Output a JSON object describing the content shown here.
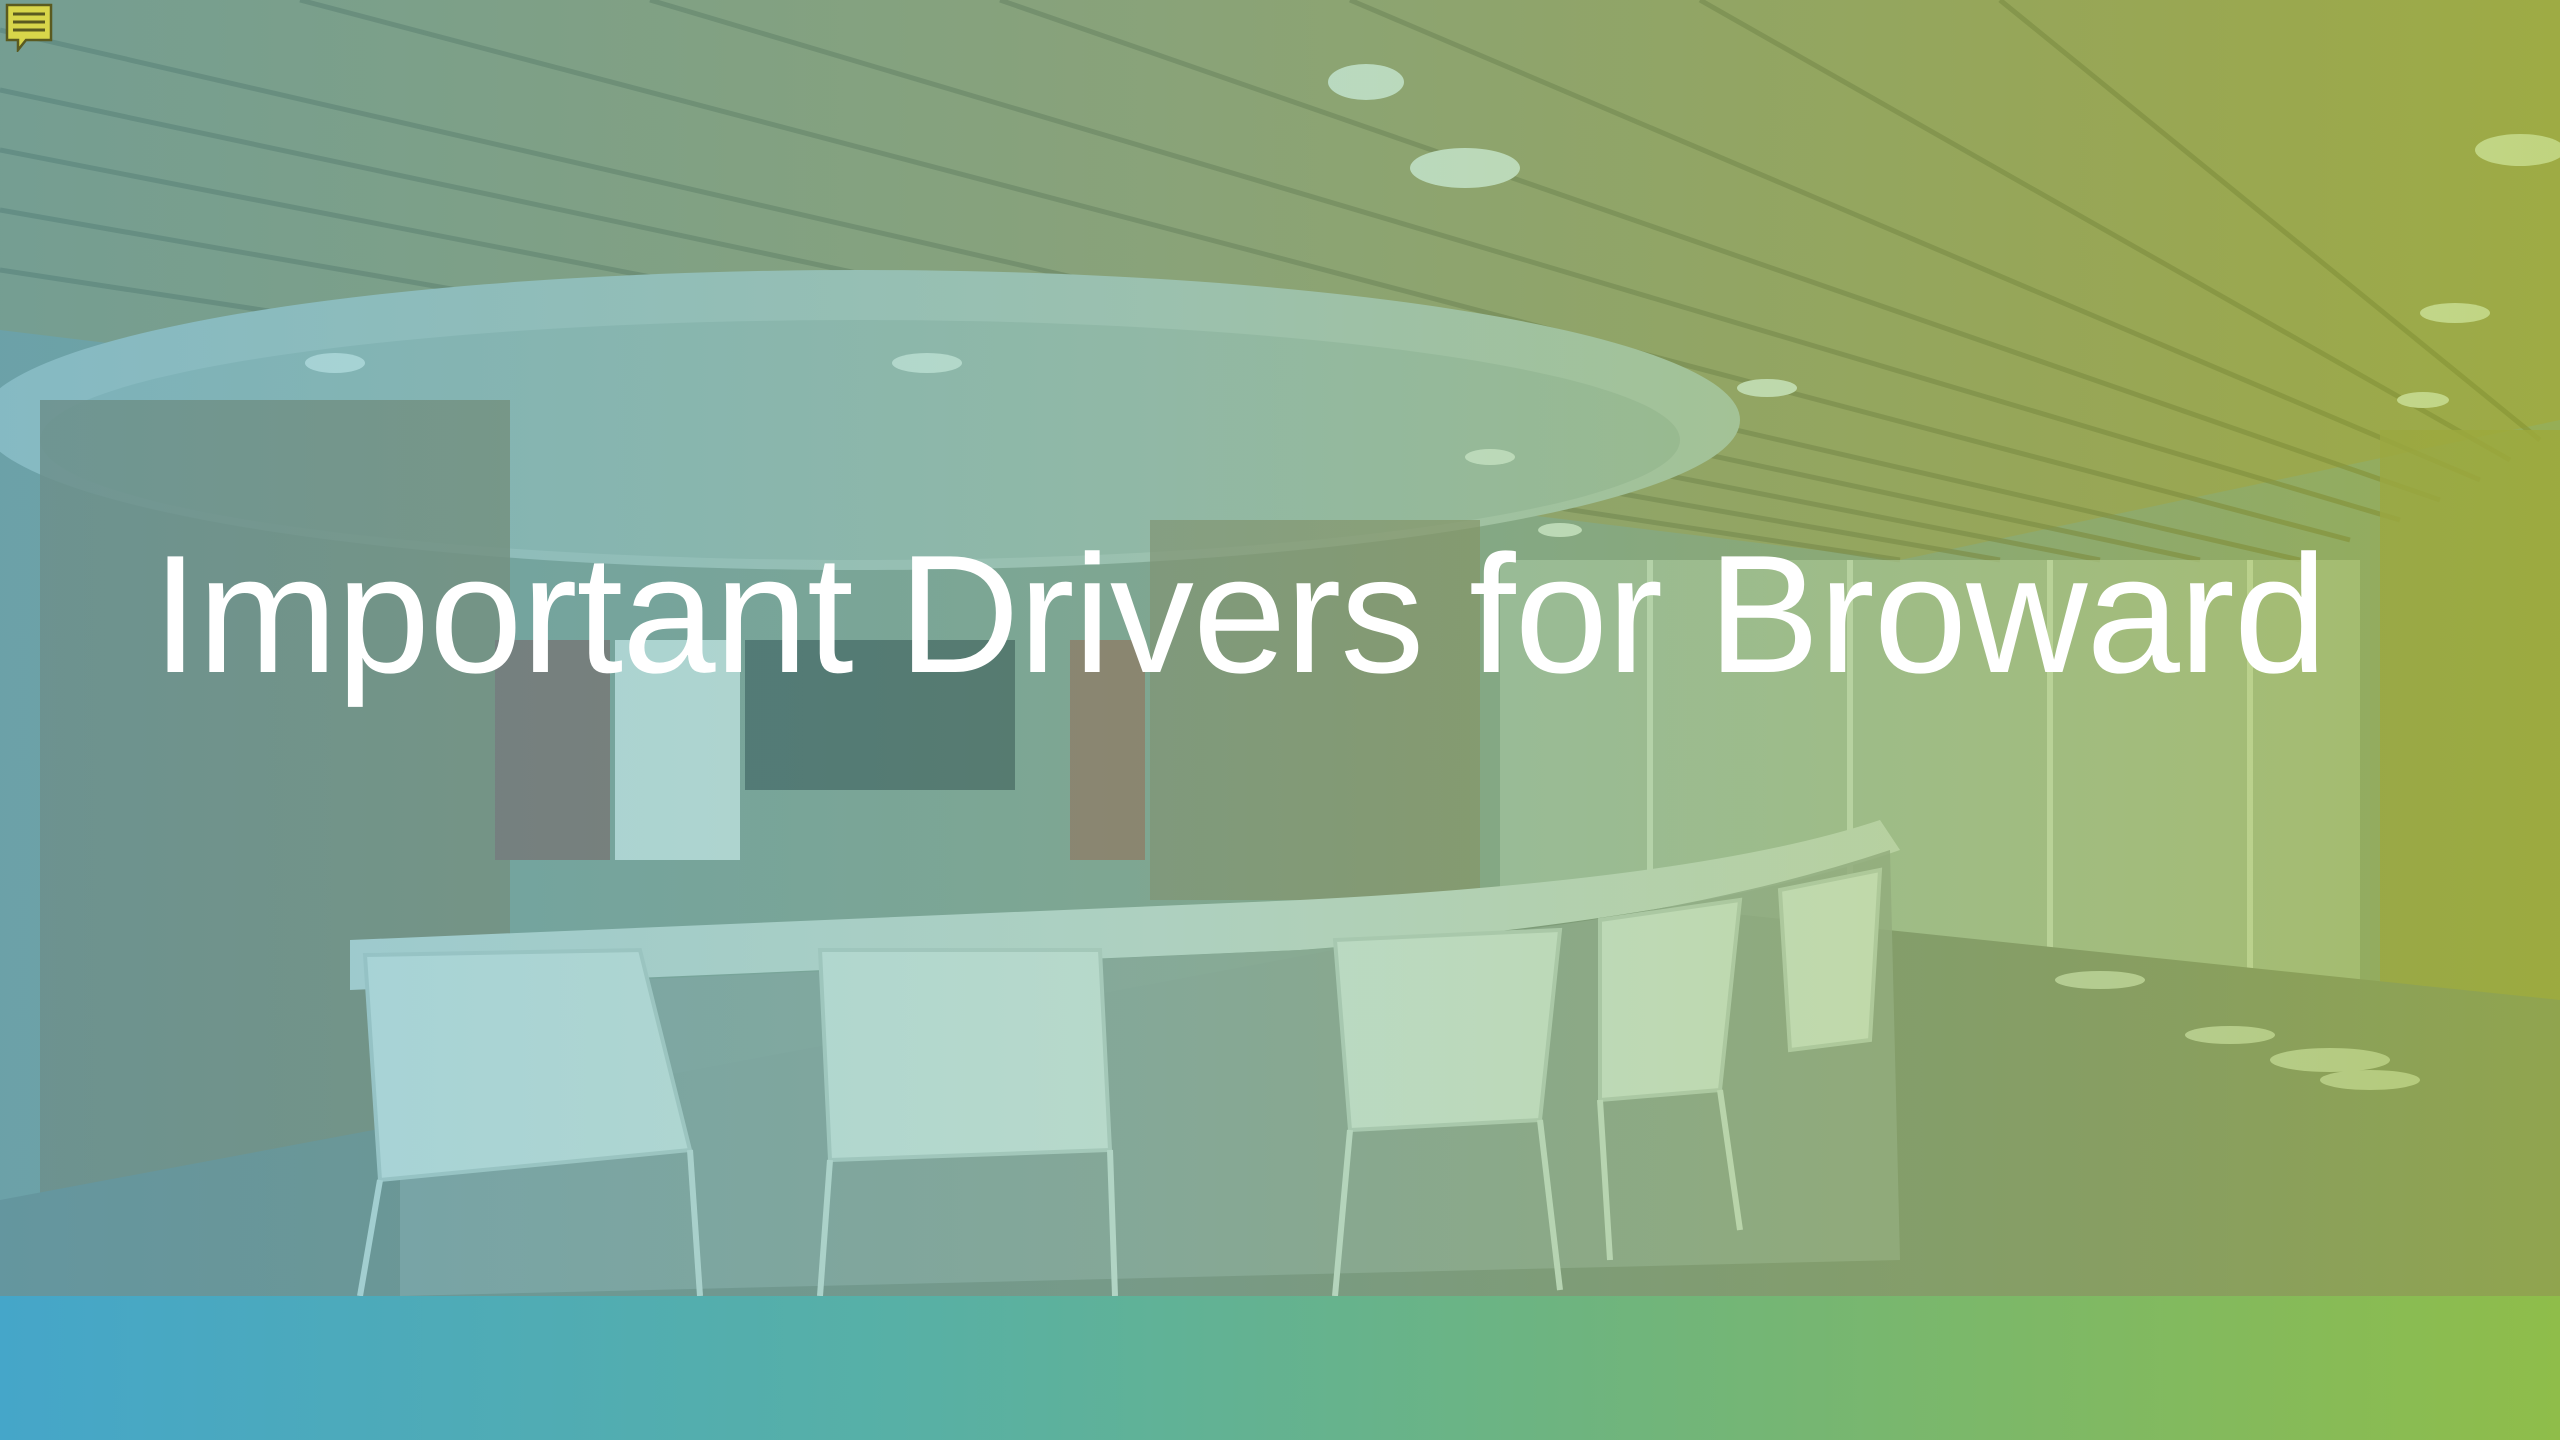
{
  "slide": {
    "title": "Important Drivers for Broward"
  },
  "icons": {
    "comment": "comment-icon"
  },
  "colors": {
    "band_left": "#45a6c9",
    "band_right": "#8fbd4a",
    "title_text": "#ffffff"
  }
}
